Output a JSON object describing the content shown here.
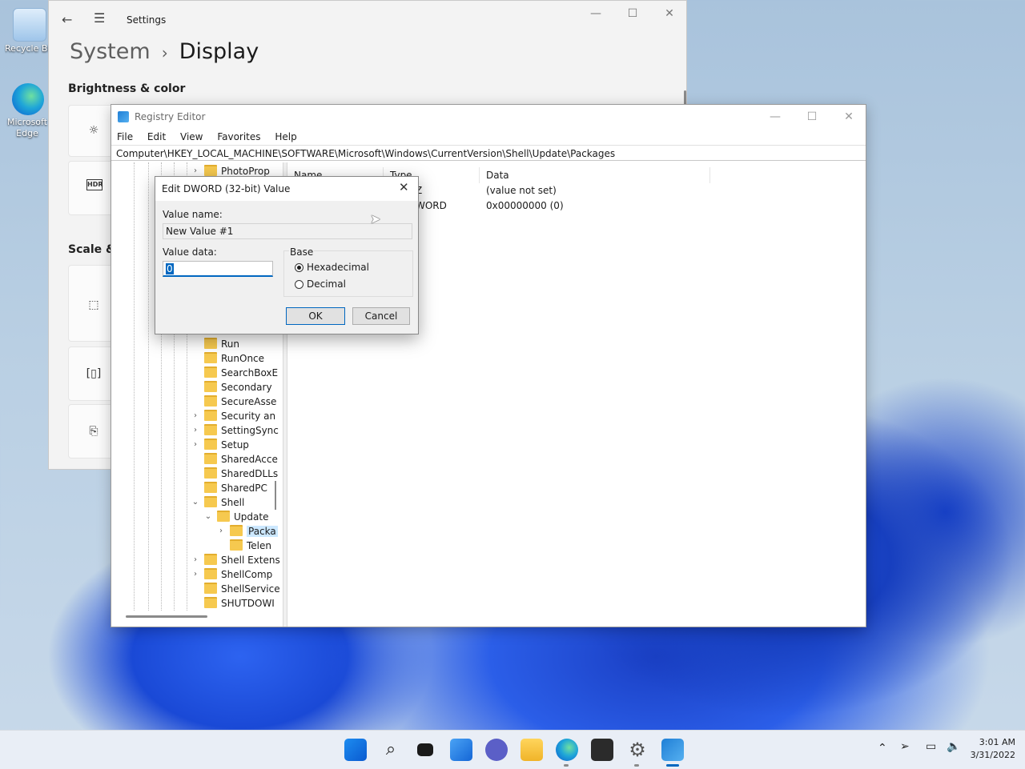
{
  "desktop": {
    "icons": [
      {
        "label": "Recycle Bin"
      },
      {
        "label": "Microsoft Edge"
      }
    ]
  },
  "settings": {
    "title": "Settings",
    "crumb_parent": "System",
    "crumb_current": "Display",
    "section_brightness": "Brightness & color",
    "section_scale": "Scale & layout",
    "hdr_label": "HDR"
  },
  "regedit": {
    "title": "Registry Editor",
    "menu": [
      "File",
      "Edit",
      "View",
      "Favorites",
      "Help"
    ],
    "address": "Computer\\HKEY_LOCAL_MACHINE\\SOFTWARE\\Microsoft\\Windows\\CurrentVersion\\Shell\\Update\\Packages",
    "columns": [
      "Name",
      "Type",
      "Data"
    ],
    "rows": [
      {
        "type_fragment": "Z",
        "data": "(value not set)"
      },
      {
        "type_fragment": "WORD",
        "data": "0x00000000 (0)"
      }
    ],
    "tree": [
      {
        "label": "PhotoProp",
        "chevron": ">"
      },
      {
        "label": "Run",
        "chevron": ""
      },
      {
        "label": "RunOnce",
        "chevron": ""
      },
      {
        "label": "SearchBoxE",
        "chevron": ""
      },
      {
        "label": "Secondary",
        "chevron": ""
      },
      {
        "label": "SecureAsse",
        "chevron": ""
      },
      {
        "label": "Security an",
        "chevron": ">"
      },
      {
        "label": "SettingSync",
        "chevron": ">"
      },
      {
        "label": "Setup",
        "chevron": ">"
      },
      {
        "label": "SharedAcce",
        "chevron": ""
      },
      {
        "label": "SharedDLLs",
        "chevron": ""
      },
      {
        "label": "SharedPC",
        "chevron": ""
      },
      {
        "label": "Shell",
        "chevron": "v"
      },
      {
        "label": "Update",
        "chevron": "v"
      },
      {
        "label": "Packa",
        "chevron": ">"
      },
      {
        "label": "Telen",
        "chevron": ""
      },
      {
        "label": "Shell Extens",
        "chevron": ">"
      },
      {
        "label": "ShellComp",
        "chevron": ">"
      },
      {
        "label": "ShellService",
        "chevron": ""
      },
      {
        "label": "SHUTDOWI",
        "chevron": ""
      }
    ]
  },
  "dialog": {
    "title": "Edit DWORD (32-bit) Value",
    "value_name_label": "Value name:",
    "value_name": "New Value #1",
    "value_data_label": "Value data:",
    "value_data": "0",
    "base_label": "Base",
    "hex_label": "Hexadecimal",
    "dec_label": "Decimal",
    "selected_base": "Hexadecimal",
    "ok_label": "OK",
    "cancel_label": "Cancel"
  },
  "taskbar": {
    "time": "3:01 AM",
    "date": "3/31/2022",
    "apps": [
      "start-icon",
      "search-icon",
      "task-view-icon",
      "widgets-icon",
      "chat-icon",
      "file-explorer-icon",
      "edge-icon",
      "store-icon",
      "settings-icon",
      "regedit-icon"
    ]
  },
  "colors": {
    "accent": "#0067c0",
    "selection": "#cce8ff",
    "folder": "#f6c94f"
  }
}
